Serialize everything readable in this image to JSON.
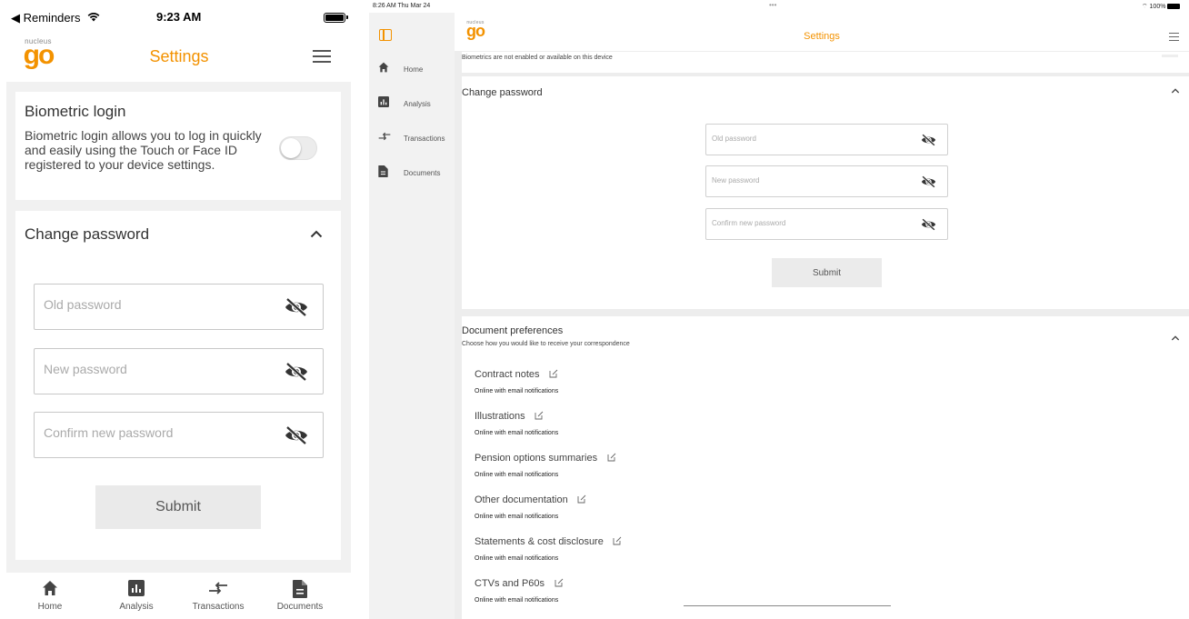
{
  "phone": {
    "status": {
      "back_app": "◀ Reminders",
      "time": "9:23 AM"
    },
    "header": {
      "logo_small": "nucleus",
      "logo_big": "go",
      "title": "Settings"
    },
    "biometric": {
      "title": "Biometric login",
      "description": "Biometric login allows you to log in quickly and easily using the Touch or Face ID registered to your device settings.",
      "enabled": false
    },
    "change_password": {
      "title": "Change password",
      "old_placeholder": "Old password",
      "new_placeholder": "New password",
      "confirm_placeholder": "Confirm new password",
      "submit_label": "Submit"
    },
    "tabs": [
      {
        "label": "Home",
        "icon": "home-icon"
      },
      {
        "label": "Analysis",
        "icon": "analysis-icon"
      },
      {
        "label": "Transactions",
        "icon": "transactions-icon"
      },
      {
        "label": "Documents",
        "icon": "documents-icon"
      }
    ]
  },
  "tablet": {
    "status": {
      "time": "8:26 AM  Thu Mar 24",
      "dots": "•••",
      "battery": "100%"
    },
    "header": {
      "logo_small": "nucleus",
      "logo_big": "go",
      "title": "Settings"
    },
    "sidebar": [
      {
        "label": "Home",
        "icon": "home-icon"
      },
      {
        "label": "Analysis",
        "icon": "analysis-icon"
      },
      {
        "label": "Transactions",
        "icon": "transactions-icon"
      },
      {
        "label": "Documents",
        "icon": "documents-icon"
      }
    ],
    "biometric_note": "Biometrics are not enabled or available on this device",
    "change_password": {
      "title": "Change password",
      "old_placeholder": "Old password",
      "new_placeholder": "New password",
      "confirm_placeholder": "Confirm new password",
      "submit_label": "Submit"
    },
    "documents": {
      "title": "Document preferences",
      "subtitle": "Choose how you would like to receive your correspondence",
      "items": [
        {
          "name": "Contract notes",
          "pref": "Online with email notifications"
        },
        {
          "name": "Illustrations",
          "pref": "Online with email notifications"
        },
        {
          "name": "Pension options summaries",
          "pref": "Online with email notifications"
        },
        {
          "name": "Other documentation",
          "pref": "Online with email notifications"
        },
        {
          "name": "Statements & cost disclosure",
          "pref": "Online with email notifications"
        },
        {
          "name": "CTVs and P60s",
          "pref": "Online with email notifications"
        }
      ]
    }
  },
  "colors": {
    "accent": "#f39200",
    "background": "#f1f1f1",
    "card": "#ffffff"
  }
}
